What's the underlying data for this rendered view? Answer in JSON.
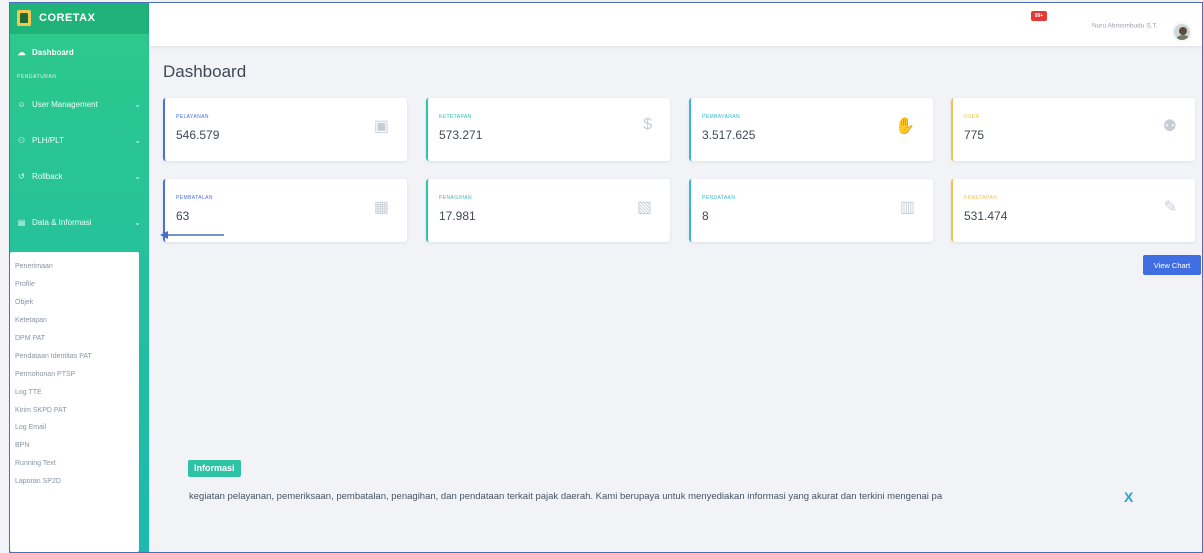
{
  "app": {
    "brand": "CORETAX"
  },
  "sidebar": {
    "dashboard": "Dashboard",
    "section_label": "PENGATURAN",
    "items": [
      {
        "label": "User Management"
      },
      {
        "label": "PLH/PLT"
      },
      {
        "label": "Rollback"
      },
      {
        "label": "Data & Informasi"
      }
    ],
    "submenu": [
      "Penerimaan",
      "Profile",
      "Objek",
      "Ketetapan",
      "DPM PAT",
      "Pendataan Identitas PAT",
      "Permohonan PTSP",
      "Log TTE",
      "Kirim SKPD PAT",
      "Log Email",
      "BPN",
      "Running Text",
      "Laporan SP2D"
    ]
  },
  "topbar": {
    "notification_badge": "99+",
    "user_name": "Nuru Abrosmbudu S.T."
  },
  "main": {
    "title": "Dashboard",
    "cards": [
      {
        "label": "PELAYANAN",
        "value": "546.579",
        "icon": "desktop-icon",
        "color": "#4a6ee0"
      },
      {
        "label": "KETETAPAN",
        "value": "573.271",
        "icon": "dollar-icon",
        "color": "#2fc3b0"
      },
      {
        "label": "PEMBAYARAN",
        "value": "3.517.625",
        "icon": "hand-dollar-icon",
        "color": "#3bb6d6"
      },
      {
        "label": "USER",
        "value": "775",
        "icon": "users-icon",
        "color": "#f2c14e"
      },
      {
        "label": "PEMBATALAN",
        "value": "63",
        "icon": "clipboard-icon",
        "color": "#4a6ee0"
      },
      {
        "label": "PENAGIHAN",
        "value": "17.981",
        "icon": "invoice-icon",
        "color": "#2fc3b0"
      },
      {
        "label": "PENDATAAN",
        "value": "8",
        "icon": "file-icon",
        "color": "#3bb6d6"
      },
      {
        "label": "PENETAPAN",
        "value": "531.474",
        "icon": "edit-icon",
        "color": "#f2c14e"
      }
    ],
    "view_chart_label": "View Chart",
    "info_label": "Informasi",
    "ticker_text": "kegiatan pelayanan, pemeriksaan, pembatalan, penagihan, dan pendataan terkait pajak daerah. Kami berupaya untuk menyediakan informasi yang akurat dan terkini mengenai pa",
    "close_label": "X"
  }
}
